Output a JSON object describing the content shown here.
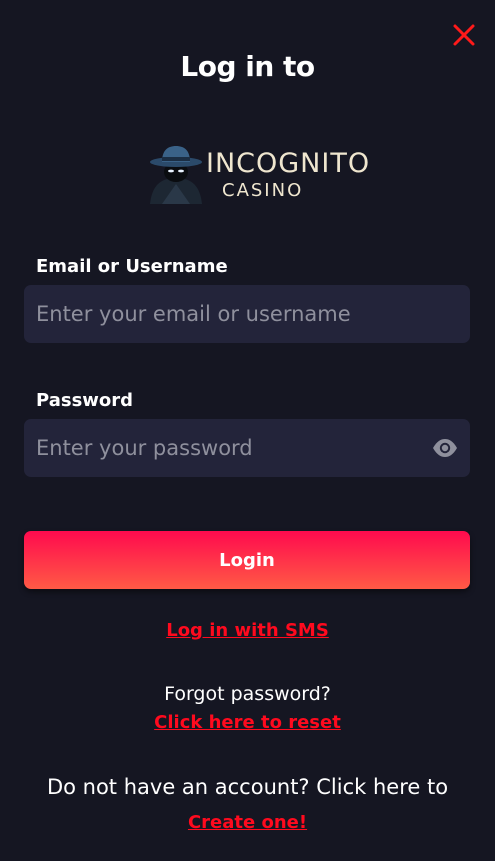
{
  "header": {
    "title": "Log in to",
    "close_icon": "close-icon"
  },
  "logo": {
    "word": "INCOGNITO",
    "sub": "CASINO",
    "icon": "spy-detective-icon"
  },
  "form": {
    "email": {
      "label": "Email or Username",
      "placeholder": "Enter your email or username",
      "value": ""
    },
    "password": {
      "label": "Password",
      "placeholder": "Enter your password",
      "value": "",
      "toggle_icon": "eye-icon"
    },
    "login_label": "Login"
  },
  "links": {
    "sms": "Log in with SMS",
    "forgot_text": "Forgot password?",
    "reset": "Click here to reset",
    "no_account_text": "Do not have an account? Click here to",
    "create": "Create one!"
  },
  "colors": {
    "background": "#151622",
    "input_bg": "#23243a",
    "accent": "#ff0a1e",
    "button_gradient_top": "#ff0a4e",
    "button_gradient_bottom": "#ff5a45"
  }
}
